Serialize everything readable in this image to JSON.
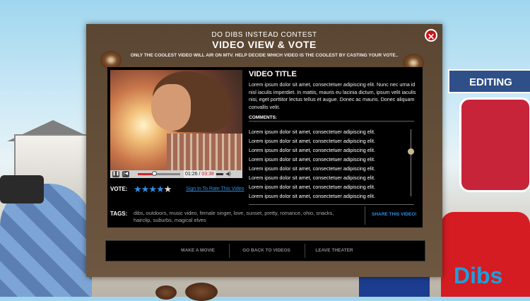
{
  "modal": {
    "contest_title": "DO DIBS INSTEAD CONTEST",
    "title": "VIDEO VIEW & VOTE",
    "subtitle": "ONLY THE COOLEST VIDEO WILL AIR ON MTV. HELP DECIDE WHICH VIDEO IS THE COOLEST BY CASTING YOUR VOTE..",
    "close_icon": "✕"
  },
  "player": {
    "current_time": "01:26",
    "total_time": "03:38",
    "progress": 0.39,
    "play_pause_icon": "pause-icon",
    "volume_icon": "speaker-icon"
  },
  "vote": {
    "label": "VOTE:",
    "rating": 4,
    "max": 5,
    "sign_in": "Sign In To Rate This Video"
  },
  "video": {
    "title": "VIDEO TITLE",
    "description": "Lorem ipsum dolor sit amet, consectetuer adipiscing elit. Nunc nec urna id nisl iaculis imperdiet. In mattis, mauris eu lacinia dictum, ipsum velit iaculis nisi, eget porttitor lectus tellus et augue. Donec ac mauris. Donec aliquam convallis velit."
  },
  "comments": {
    "heading": "COMMENTS:",
    "items": [
      "Lorem ipsum dolor sit amet, consectetuer adipiscing elit.",
      "Lorem ipsum dolor sit amet, consectetuer adipiscing elit.",
      "Lorem ipsum dolor sit amet, consectetuer adipiscing elit.",
      "Lorem ipsum dolor sit amet, consectetuer adipiscing elit.",
      "Lorem ipsum dolor sit amet, consectetuer adipiscing elit.",
      "Lorem ipsum dolor sit amet, consectetuer adipiscing elit.",
      "Lorem ipsum dolor sit amet, consectetuer adipiscing elit.",
      "Lorem ipsum dolor sit amet, consectetuer adipiscing elit."
    ]
  },
  "tags": {
    "label": "TAGS:",
    "text": "dibs, outdoors, music video, female singer, love, sunset, pretty, romance, ohio, snacks, hairclip, suburbs, magical elves",
    "share": "SHARE THIS VIDEO!"
  },
  "nav": {
    "make_movie": "MAKE A MOVIE",
    "back_to_videos": "GO BACK TO VIDEOS",
    "leave_theater": "LEAVE THEATER"
  },
  "background": {
    "sign_text": "EDITING ROO",
    "can_text": "Dibs"
  },
  "colors": {
    "accent_blue": "#2c8fe4",
    "close_red": "#c8141a",
    "modal_brown": "#5a4632"
  }
}
